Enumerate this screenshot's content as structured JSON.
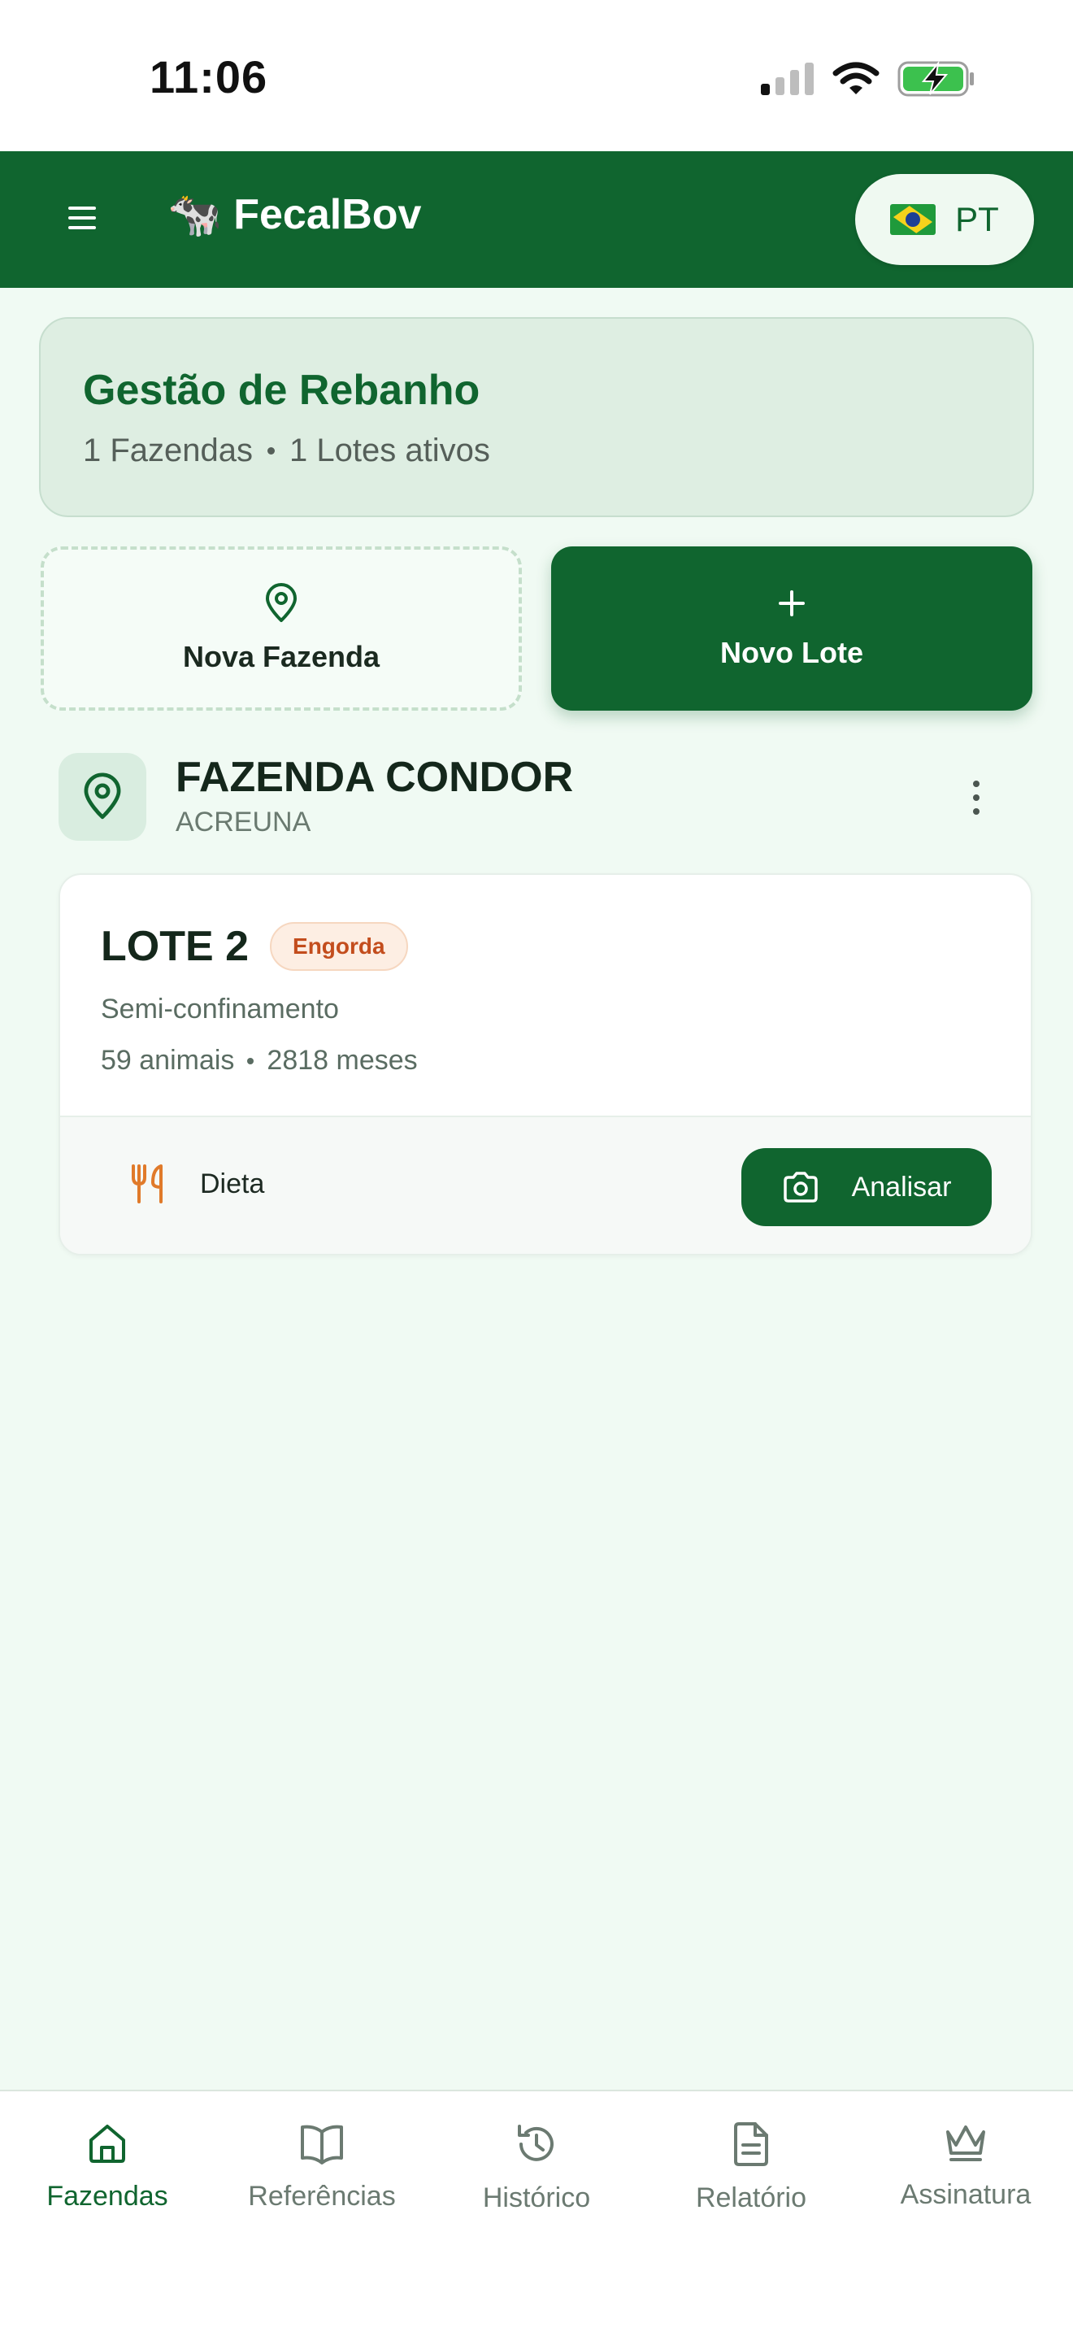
{
  "status_bar": {
    "time": "11:06"
  },
  "header": {
    "brand_emoji": "🐄",
    "brand_name": "FecalBov",
    "language_code": "PT",
    "flag": "brazil-flag-icon"
  },
  "summary": {
    "title": "Gestão de Rebanho",
    "farms_count": "1 Fazendas",
    "lots_count": "1 Lotes ativos"
  },
  "actions": {
    "new_farm_label": "Nova Fazenda",
    "new_lot_label": "Novo Lote"
  },
  "farm": {
    "name": "FAZENDA CONDOR",
    "location": "ACREUNA"
  },
  "lot": {
    "title": "LOTE 2",
    "badge": "Engorda",
    "system": "Semi-confinamento",
    "animals": "59 animais",
    "age": "2818 meses",
    "diet_label": "Dieta",
    "analyze_label": "Analisar"
  },
  "nav": {
    "items": [
      {
        "label": "Fazendas",
        "icon": "home-icon",
        "active": true
      },
      {
        "label": "Referências",
        "icon": "book-icon",
        "active": false
      },
      {
        "label": "Histórico",
        "icon": "history-icon",
        "active": false
      },
      {
        "label": "Relatório",
        "icon": "document-icon",
        "active": false
      },
      {
        "label": "Assinatura",
        "icon": "crown-icon",
        "active": false
      }
    ]
  },
  "colors": {
    "primary": "#10652f",
    "background": "#f0faf3",
    "badge_text": "#c34d1d",
    "diet_icon": "#e07a2a"
  }
}
